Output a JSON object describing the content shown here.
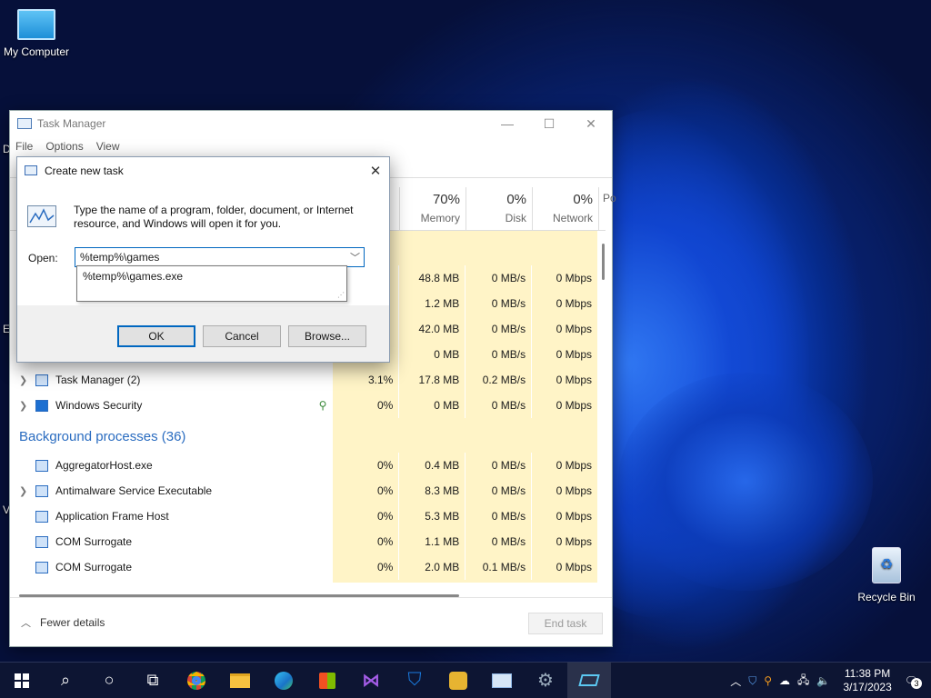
{
  "desktop": {
    "my_computer": "My Computer",
    "recycle_bin": "Recycle Bin",
    "edge_letters": [
      "D",
      "E",
      "V"
    ]
  },
  "task_manager": {
    "title": "Task Manager",
    "menu": [
      "File",
      "Options",
      "View"
    ],
    "columns": [
      {
        "percent": "70%",
        "label": "Memory"
      },
      {
        "percent": "0%",
        "label": "Disk"
      },
      {
        "percent": "0%",
        "label": "Network"
      },
      {
        "percent": "",
        "label": "Po"
      }
    ],
    "hidden_rows": [
      {
        "cpu": "",
        "memory": "48.8 MB",
        "disk": "0 MB/s",
        "network": "0 Mbps"
      },
      {
        "cpu": "",
        "memory": "1.2 MB",
        "disk": "0 MB/s",
        "network": "0 Mbps"
      },
      {
        "cpu": "",
        "memory": "42.0 MB",
        "disk": "0 MB/s",
        "network": "0 Mbps"
      },
      {
        "cpu": "",
        "memory": "0 MB",
        "disk": "0 MB/s",
        "network": "0 Mbps"
      }
    ],
    "apps": [
      {
        "name": "Task Manager (2)",
        "cpu": "3.1%",
        "memory": "17.8 MB",
        "disk": "0.2 MB/s",
        "network": "0 Mbps"
      },
      {
        "name": "Windows Security",
        "cpu": "0%",
        "memory": "0 MB",
        "disk": "0 MB/s",
        "network": "0 Mbps"
      }
    ],
    "background_header": "Background processes (36)",
    "background": [
      {
        "name": "AggregatorHost.exe",
        "cpu": "0%",
        "memory": "0.4 MB",
        "disk": "0 MB/s",
        "network": "0 Mbps"
      },
      {
        "name": "Antimalware Service Executable",
        "cpu": "0%",
        "memory": "8.3 MB",
        "disk": "0 MB/s",
        "network": "0 Mbps"
      },
      {
        "name": "Application Frame Host",
        "cpu": "0%",
        "memory": "5.3 MB",
        "disk": "0 MB/s",
        "network": "0 Mbps"
      },
      {
        "name": "COM Surrogate",
        "cpu": "0%",
        "memory": "1.1 MB",
        "disk": "0 MB/s",
        "network": "0 Mbps"
      },
      {
        "name": "COM Surrogate",
        "cpu": "0%",
        "memory": "2.0 MB",
        "disk": "0.1 MB/s",
        "network": "0 Mbps"
      }
    ],
    "fewer_details": "Fewer details",
    "end_task": "End task"
  },
  "dialog": {
    "title": "Create new task",
    "description": "Type the name of a program, folder, document, or Internet resource, and Windows will open it for you.",
    "open_label": "Open:",
    "input_value": "%temp%\\games",
    "suggestion": "%temp%\\games.exe",
    "ok": "OK",
    "cancel": "Cancel",
    "browse": "Browse..."
  },
  "taskbar": {
    "time": "11:38 PM",
    "date": "3/17/2023",
    "notification_count": "3"
  }
}
